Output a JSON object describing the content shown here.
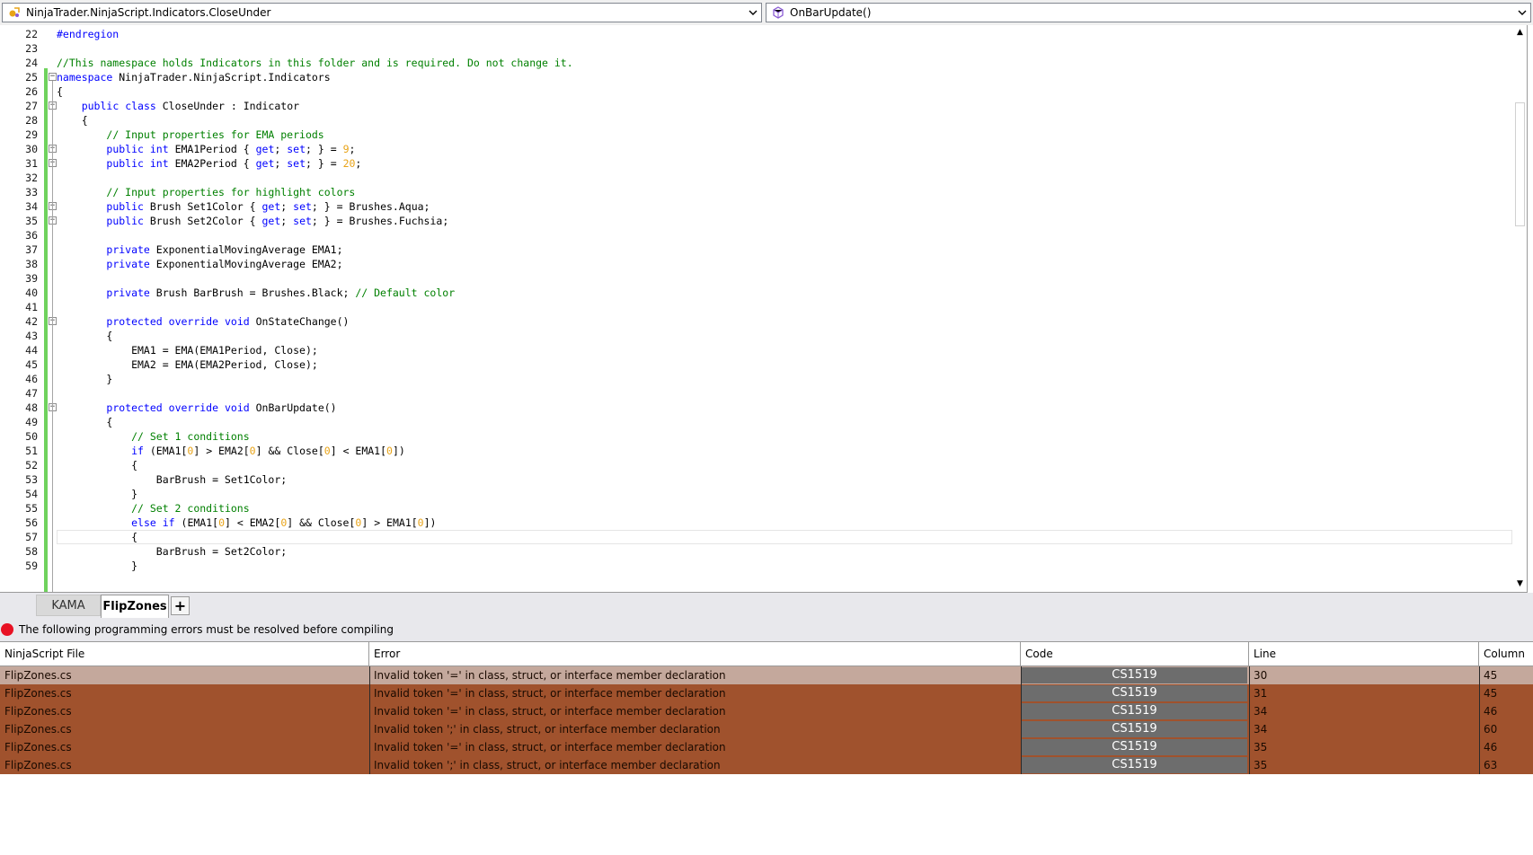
{
  "nav": {
    "class_dropdown": "NinjaTrader.NinjaScript.Indicators.CloseUnder",
    "member_dropdown": "OnBarUpdate()"
  },
  "editor": {
    "lines": [
      {
        "n": "22",
        "tokens": [
          {
            "t": "#endregion",
            "c": "pp"
          }
        ]
      },
      {
        "n": "23",
        "tokens": []
      },
      {
        "n": "24",
        "tokens": [
          {
            "t": "//This namespace holds Indicators in this folder and is required. Do not change it.",
            "c": "cm"
          }
        ]
      },
      {
        "n": "25",
        "tokens": [
          {
            "t": "namespace",
            "c": "kw"
          },
          {
            "t": " NinjaTrader.NinjaScript.Indicators",
            "c": "tx"
          }
        ]
      },
      {
        "n": "26",
        "tokens": [
          {
            "t": "{",
            "c": "tx"
          }
        ]
      },
      {
        "n": "27",
        "tokens": [
          {
            "t": "    ",
            "c": "tx"
          },
          {
            "t": "public",
            "c": "kw"
          },
          {
            "t": " ",
            "c": "tx"
          },
          {
            "t": "class",
            "c": "kw"
          },
          {
            "t": " CloseUnder : Indicator",
            "c": "tx"
          }
        ]
      },
      {
        "n": "28",
        "tokens": [
          {
            "t": "    {",
            "c": "tx"
          }
        ]
      },
      {
        "n": "29",
        "tokens": [
          {
            "t": "        ",
            "c": "tx"
          },
          {
            "t": "// Input properties for EMA periods",
            "c": "cm"
          }
        ]
      },
      {
        "n": "30",
        "tokens": [
          {
            "t": "        ",
            "c": "tx"
          },
          {
            "t": "public",
            "c": "kw"
          },
          {
            "t": " ",
            "c": "tx"
          },
          {
            "t": "int",
            "c": "kw"
          },
          {
            "t": " EMA1Period { ",
            "c": "tx"
          },
          {
            "t": "get",
            "c": "kw"
          },
          {
            "t": "; ",
            "c": "tx"
          },
          {
            "t": "set",
            "c": "kw"
          },
          {
            "t": "; } = ",
            "c": "tx"
          },
          {
            "t": "9",
            "c": "num"
          },
          {
            "t": ";",
            "c": "tx"
          }
        ]
      },
      {
        "n": "31",
        "tokens": [
          {
            "t": "        ",
            "c": "tx"
          },
          {
            "t": "public",
            "c": "kw"
          },
          {
            "t": " ",
            "c": "tx"
          },
          {
            "t": "int",
            "c": "kw"
          },
          {
            "t": " EMA2Period { ",
            "c": "tx"
          },
          {
            "t": "get",
            "c": "kw"
          },
          {
            "t": "; ",
            "c": "tx"
          },
          {
            "t": "set",
            "c": "kw"
          },
          {
            "t": "; } = ",
            "c": "tx"
          },
          {
            "t": "20",
            "c": "num"
          },
          {
            "t": ";",
            "c": "tx"
          }
        ]
      },
      {
        "n": "32",
        "tokens": []
      },
      {
        "n": "33",
        "tokens": [
          {
            "t": "        ",
            "c": "tx"
          },
          {
            "t": "// Input properties for highlight colors",
            "c": "cm"
          }
        ]
      },
      {
        "n": "34",
        "tokens": [
          {
            "t": "        ",
            "c": "tx"
          },
          {
            "t": "public",
            "c": "kw"
          },
          {
            "t": " Brush Set1Color { ",
            "c": "tx"
          },
          {
            "t": "get",
            "c": "kw"
          },
          {
            "t": "; ",
            "c": "tx"
          },
          {
            "t": "set",
            "c": "kw"
          },
          {
            "t": "; } = Brushes.Aqua;",
            "c": "tx"
          }
        ]
      },
      {
        "n": "35",
        "tokens": [
          {
            "t": "        ",
            "c": "tx"
          },
          {
            "t": "public",
            "c": "kw"
          },
          {
            "t": " Brush Set2Color { ",
            "c": "tx"
          },
          {
            "t": "get",
            "c": "kw"
          },
          {
            "t": "; ",
            "c": "tx"
          },
          {
            "t": "set",
            "c": "kw"
          },
          {
            "t": "; } = Brushes.Fuchsia;",
            "c": "tx"
          }
        ]
      },
      {
        "n": "36",
        "tokens": []
      },
      {
        "n": "37",
        "tokens": [
          {
            "t": "        ",
            "c": "tx"
          },
          {
            "t": "private",
            "c": "kw"
          },
          {
            "t": " ExponentialMovingAverage EMA1;",
            "c": "tx"
          }
        ]
      },
      {
        "n": "38",
        "tokens": [
          {
            "t": "        ",
            "c": "tx"
          },
          {
            "t": "private",
            "c": "kw"
          },
          {
            "t": " ExponentialMovingAverage EMA2;",
            "c": "tx"
          }
        ]
      },
      {
        "n": "39",
        "tokens": []
      },
      {
        "n": "40",
        "tokens": [
          {
            "t": "        ",
            "c": "tx"
          },
          {
            "t": "private",
            "c": "kw"
          },
          {
            "t": " Brush BarBrush = Brushes.Black; ",
            "c": "tx"
          },
          {
            "t": "// Default color",
            "c": "cm"
          }
        ]
      },
      {
        "n": "41",
        "tokens": []
      },
      {
        "n": "42",
        "tokens": [
          {
            "t": "        ",
            "c": "tx"
          },
          {
            "t": "protected",
            "c": "kw"
          },
          {
            "t": " ",
            "c": "tx"
          },
          {
            "t": "override",
            "c": "kw"
          },
          {
            "t": " ",
            "c": "tx"
          },
          {
            "t": "void",
            "c": "kw"
          },
          {
            "t": " OnStateChange()",
            "c": "tx"
          }
        ]
      },
      {
        "n": "43",
        "tokens": [
          {
            "t": "        {",
            "c": "tx"
          }
        ]
      },
      {
        "n": "44",
        "tokens": [
          {
            "t": "            EMA1 = EMA(EMA1Period, Close);",
            "c": "tx"
          }
        ]
      },
      {
        "n": "45",
        "tokens": [
          {
            "t": "            EMA2 = EMA(EMA2Period, Close);",
            "c": "tx"
          }
        ]
      },
      {
        "n": "46",
        "tokens": [
          {
            "t": "        }",
            "c": "tx"
          }
        ]
      },
      {
        "n": "47",
        "tokens": []
      },
      {
        "n": "48",
        "tokens": [
          {
            "t": "        ",
            "c": "tx"
          },
          {
            "t": "protected",
            "c": "kw"
          },
          {
            "t": " ",
            "c": "tx"
          },
          {
            "t": "override",
            "c": "kw"
          },
          {
            "t": " ",
            "c": "tx"
          },
          {
            "t": "void",
            "c": "kw"
          },
          {
            "t": " OnBarUpdate()",
            "c": "tx"
          }
        ]
      },
      {
        "n": "49",
        "tokens": [
          {
            "t": "        {",
            "c": "tx"
          }
        ]
      },
      {
        "n": "50",
        "tokens": [
          {
            "t": "            ",
            "c": "tx"
          },
          {
            "t": "// Set 1 conditions",
            "c": "cm"
          }
        ]
      },
      {
        "n": "51",
        "tokens": [
          {
            "t": "            ",
            "c": "tx"
          },
          {
            "t": "if",
            "c": "kw"
          },
          {
            "t": " (EMA1[",
            "c": "tx"
          },
          {
            "t": "0",
            "c": "num"
          },
          {
            "t": "] > EMA2[",
            "c": "tx"
          },
          {
            "t": "0",
            "c": "num"
          },
          {
            "t": "] && Close[",
            "c": "tx"
          },
          {
            "t": "0",
            "c": "num"
          },
          {
            "t": "] < EMA1[",
            "c": "tx"
          },
          {
            "t": "0",
            "c": "num"
          },
          {
            "t": "])",
            "c": "tx"
          }
        ]
      },
      {
        "n": "52",
        "tokens": [
          {
            "t": "            {",
            "c": "tx"
          }
        ]
      },
      {
        "n": "53",
        "tokens": [
          {
            "t": "                BarBrush = Set1Color;",
            "c": "tx"
          }
        ]
      },
      {
        "n": "54",
        "tokens": [
          {
            "t": "            }",
            "c": "tx"
          }
        ]
      },
      {
        "n": "55",
        "tokens": [
          {
            "t": "            ",
            "c": "tx"
          },
          {
            "t": "// Set 2 conditions",
            "c": "cm"
          }
        ]
      },
      {
        "n": "56",
        "tokens": [
          {
            "t": "            ",
            "c": "tx"
          },
          {
            "t": "else",
            "c": "kw"
          },
          {
            "t": " ",
            "c": "tx"
          },
          {
            "t": "if",
            "c": "kw"
          },
          {
            "t": " (EMA1[",
            "c": "tx"
          },
          {
            "t": "0",
            "c": "num"
          },
          {
            "t": "] < EMA2[",
            "c": "tx"
          },
          {
            "t": "0",
            "c": "num"
          },
          {
            "t": "] && Close[",
            "c": "tx"
          },
          {
            "t": "0",
            "c": "num"
          },
          {
            "t": "] > EMA1[",
            "c": "tx"
          },
          {
            "t": "0",
            "c": "num"
          },
          {
            "t": "])",
            "c": "tx"
          }
        ]
      },
      {
        "n": "57",
        "tokens": [
          {
            "t": "            {",
            "c": "tx"
          }
        ]
      },
      {
        "n": "58",
        "tokens": [
          {
            "t": "                BarBrush = Set2Color;",
            "c": "tx"
          }
        ]
      },
      {
        "n": "59",
        "tokens": [
          {
            "t": "            }",
            "c": "tx"
          }
        ]
      }
    ],
    "fold_marker_lines": [
      "25",
      "27",
      "30",
      "31",
      "34",
      "35",
      "42",
      "48"
    ],
    "current_line": "57"
  },
  "tabs": [
    {
      "label": "KAMA",
      "active": false
    },
    {
      "label": "FlipZones",
      "active": true
    }
  ],
  "add_tab_label": "+",
  "error_banner": "The following programming errors must be resolved before compiling",
  "error_table": {
    "columns": [
      "NinjaScript File",
      "Error",
      "Code",
      "Line",
      "Column"
    ],
    "rows": [
      {
        "file": "FlipZones.cs",
        "error": "Invalid token '=' in class, struct, or interface member declaration",
        "code": "CS1519",
        "line": "30",
        "column": "45",
        "selected": true
      },
      {
        "file": "FlipZones.cs",
        "error": "Invalid token '=' in class, struct, or interface member declaration",
        "code": "CS1519",
        "line": "31",
        "column": "45",
        "selected": false
      },
      {
        "file": "FlipZones.cs",
        "error": "Invalid token '=' in class, struct, or interface member declaration",
        "code": "CS1519",
        "line": "34",
        "column": "46",
        "selected": false
      },
      {
        "file": "FlipZones.cs",
        "error": "Invalid token ';' in class, struct, or interface member declaration",
        "code": "CS1519",
        "line": "34",
        "column": "60",
        "selected": false
      },
      {
        "file": "FlipZones.cs",
        "error": "Invalid token '=' in class, struct, or interface member declaration",
        "code": "CS1519",
        "line": "35",
        "column": "46",
        "selected": false
      },
      {
        "file": "FlipZones.cs",
        "error": "Invalid token ';' in class, struct, or interface member declaration",
        "code": "CS1519",
        "line": "35",
        "column": "63",
        "selected": false
      }
    ]
  },
  "colors": {
    "keyword": "#0000ff",
    "comment": "#008000",
    "number": "#e8a317",
    "change_bar": "#6fd25d",
    "error_row": "#a0522d",
    "error_row_selected": "#c4a89c",
    "error_code_cell": "#6d6d6d",
    "error_dot": "#e81123"
  },
  "icons": {
    "class_dropdown": "class-icon",
    "member_dropdown": "method-icon",
    "error_banner": "error-icon"
  }
}
